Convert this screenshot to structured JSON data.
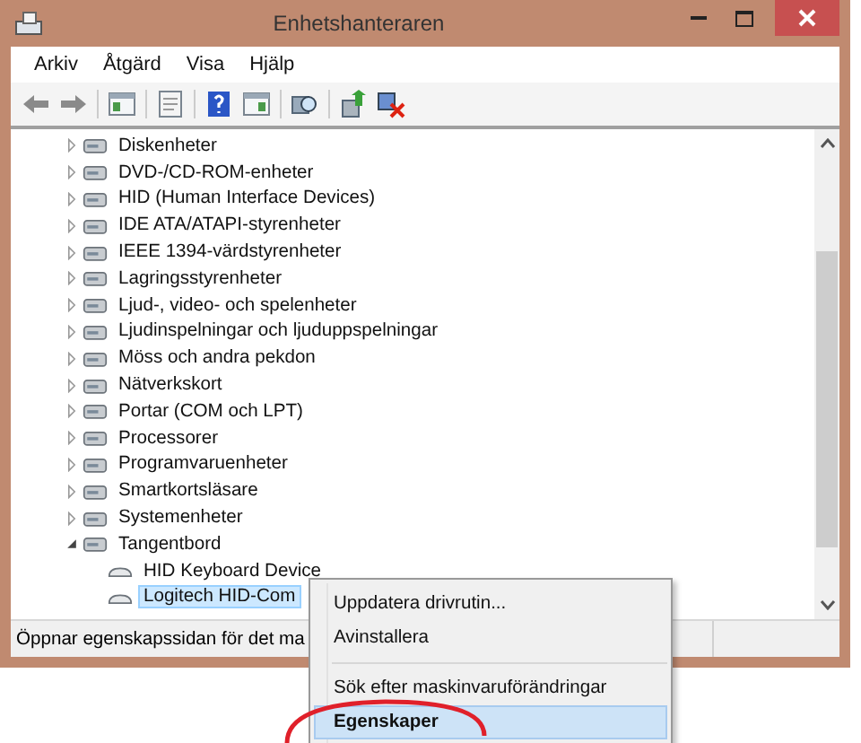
{
  "window": {
    "title": "Enhetshanteraren"
  },
  "menu_bar": [
    "Arkiv",
    "Åtgärd",
    "Visa",
    "Hjälp"
  ],
  "tree": [
    {
      "label": "Diskenheter",
      "expanded": false
    },
    {
      "label": "DVD-/CD-ROM-enheter",
      "expanded": false
    },
    {
      "label": "HID (Human Interface Devices)",
      "expanded": false
    },
    {
      "label": "IDE ATA/ATAPI-styrenheter",
      "expanded": false
    },
    {
      "label": "IEEE 1394-värdstyrenheter",
      "expanded": false
    },
    {
      "label": "Lagringsstyrenheter",
      "expanded": false
    },
    {
      "label": "Ljud-, video- och spelenheter",
      "expanded": false
    },
    {
      "label": "Ljudinspelningar och ljuduppspelningar",
      "expanded": false
    },
    {
      "label": "Möss och andra pekdon",
      "expanded": false
    },
    {
      "label": "Nätverkskort",
      "expanded": false
    },
    {
      "label": "Portar (COM och LPT)",
      "expanded": false
    },
    {
      "label": "Processorer",
      "expanded": false
    },
    {
      "label": "Programvaruenheter",
      "expanded": false
    },
    {
      "label": "Smartkortsläsare",
      "expanded": false
    },
    {
      "label": "Systemenheter",
      "expanded": false
    },
    {
      "label": "Tangentbord",
      "expanded": true,
      "children": [
        {
          "label": "HID Keyboard Device",
          "selected": false
        },
        {
          "label": "Logitech HID-Com",
          "selected": true
        }
      ]
    }
  ],
  "status_bar": {
    "text": "Öppnar egenskapssidan för det ma"
  },
  "context_menu": [
    {
      "label": "Uppdatera drivrutin...",
      "selected": false,
      "default": false,
      "annotated": false
    },
    {
      "label": "Avinstallera",
      "selected": false,
      "default": false,
      "annotated": false
    },
    {
      "kind": "separator"
    },
    {
      "label": "Sök efter maskinvaruförändringar",
      "selected": false,
      "default": false,
      "annotated": false
    },
    {
      "label": "Egenskaper",
      "selected": true,
      "default": true,
      "annotated": true
    }
  ]
}
